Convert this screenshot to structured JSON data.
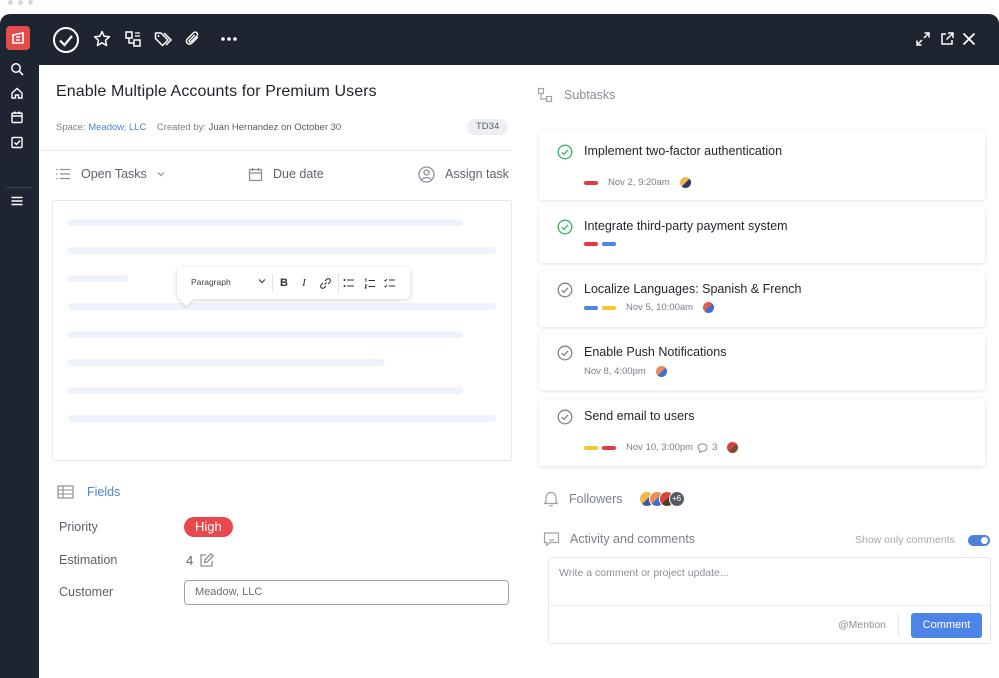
{
  "topbar": {
    "icons": [
      "check-circle-icon",
      "star-icon",
      "subtasks-icon",
      "tags-icon",
      "paperclip-icon",
      "more-icon",
      "expand-icon",
      "open-external-icon",
      "close-icon"
    ]
  },
  "task": {
    "title": "Enable Multiple Accounts for Premium Users",
    "space_label": "Space:",
    "space_value": "Meadow, LLC",
    "created_label": "Created by:",
    "created_by": "Juan Hernandez",
    "created_on": "on October 30",
    "id_tag": "TD34"
  },
  "actions": {
    "open_tasks": "Open Tasks",
    "due_date": "Due date",
    "assign_task": "Assign task"
  },
  "editor": {
    "paragraph_select": "Paragraph"
  },
  "fields": {
    "heading": "Fields",
    "priority_label": "Priority",
    "priority_value": "High",
    "estimation_label": "Estimation",
    "estimation_value": "4",
    "customer_label": "Customer",
    "customer_value": "Meadow, LLC"
  },
  "subtasks": {
    "heading": "Subtasks",
    "items": [
      {
        "title": "Implement two-factor authentication",
        "date": "Nov 2, 9:20am",
        "done": true
      },
      {
        "title": "Integrate third-party payment system",
        "date": "",
        "done": true
      },
      {
        "title": "Localize Languages: Spanish & French",
        "date": "Nov 5, 10:00am",
        "done": false
      },
      {
        "title": "Enable Push Notifications",
        "date": "Nov 8, 4:00pm",
        "done": false
      },
      {
        "title": "Send email to users",
        "date": "Nov 10, 3:00pm",
        "comments": "3",
        "done": false
      }
    ]
  },
  "followers": {
    "label": "Followers",
    "extra": "+6"
  },
  "activity": {
    "label": "Activity and comments",
    "show_only": "Show only comments",
    "placeholder": "Write a comment or project update...",
    "mention": "@Mention",
    "comment_button": "Comment"
  },
  "colors": {
    "accent": "#4d84d9",
    "danger": "#e9474b",
    "rail": "#1f2431",
    "done": "#3fb56a",
    "label_red": "#e0393e",
    "label_blue": "#4d84e8",
    "label_yellow": "#f5c534"
  }
}
